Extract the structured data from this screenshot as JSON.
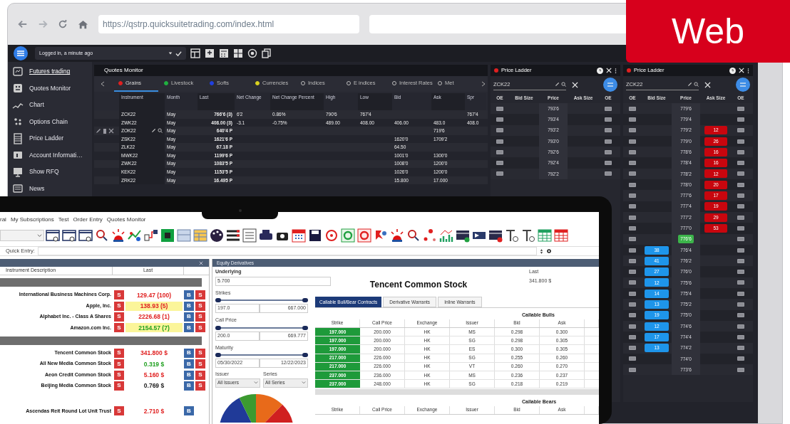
{
  "web_badge": "Web",
  "browser": {
    "url": "https://qstrp.quicksuitetrading.com/index.html"
  },
  "app": {
    "status": "Logged in, a minute ago",
    "sidebar": [
      {
        "label": "Futures trading",
        "selected": true
      },
      {
        "label": "Quotes Monitor",
        "selected": false
      },
      {
        "label": "Chart",
        "selected": false
      },
      {
        "label": "Options Chain",
        "selected": false
      },
      {
        "label": "Price Ladder",
        "selected": false
      },
      {
        "label": "Account Informati…",
        "selected": false
      },
      {
        "label": "Show RFQ",
        "selected": false
      },
      {
        "label": "News",
        "selected": false
      }
    ],
    "quotes_monitor": {
      "title": "Quotes Monitor",
      "tabs": [
        {
          "label": "Grains",
          "color": "#e02020",
          "selected": true
        },
        {
          "label": "Livestock",
          "color": "#20b040",
          "selected": false
        },
        {
          "label": "Softs",
          "color": "#2040e0",
          "selected": false
        },
        {
          "label": "Currencies",
          "color": "#d8d020",
          "selected": false
        },
        {
          "label": "Indices",
          "selected": false
        },
        {
          "label": "E indices",
          "selected": false
        },
        {
          "label": "Interest Rates",
          "selected": false
        },
        {
          "label": "Met",
          "selected": false
        }
      ],
      "columns": [
        "Instrument",
        "Month",
        "Last",
        "Net Change",
        "Net Change Percent",
        "High",
        "Low",
        "Bid",
        "Ask",
        "Spr"
      ],
      "rows": [
        {
          "instrument": "ZCK22",
          "month": "May",
          "last": "766'6 (3)",
          "net_change": "6'2",
          "net_change_percent": "0.86%",
          "high": "790'6",
          "low": "767'4",
          "spr": "767'4",
          "hovered": false
        },
        {
          "instrument": "ZWK22",
          "month": "May",
          "last": "408.00 (3)",
          "net_change": "-3.1",
          "net_change_percent": "-0.75%",
          "high": "489.00",
          "low": "408.00",
          "bid": "406.00",
          "ask": "483.0",
          "spr": "408.0",
          "hovered": false
        },
        {
          "instrument": "ZOK22",
          "month": "May",
          "last": "640'4 P",
          "ask": "719'6",
          "hovered": true
        },
        {
          "instrument": "ZSK22",
          "month": "May",
          "last": "1621'6 P",
          "bid": "1620'0",
          "ask": "1709'2",
          "hovered": false
        },
        {
          "instrument": "ZLK22",
          "month": "May",
          "last": "67.18 P",
          "bid": "64.50",
          "hovered": false
        },
        {
          "instrument": "MWK22",
          "month": "May",
          "last": "1199'6 P",
          "bid": "1001'0",
          "ask": "1300'0",
          "hovered": false
        },
        {
          "instrument": "ZWK22",
          "month": "May",
          "last": "1083'5 P",
          "bid": "1008'0",
          "ask": "1200'0",
          "hovered": false
        },
        {
          "instrument": "KEK22",
          "month": "May",
          "last": "1153'5 P",
          "bid": "1026'0",
          "ask": "1200'0",
          "hovered": false
        },
        {
          "instrument": "ZRK22",
          "month": "May",
          "last": "16.495 P",
          "bid": "15.800",
          "ask": "17.000",
          "hovered": false
        }
      ]
    },
    "price_ladders": [
      {
        "title": "Price Ladder",
        "symbol": "ZCK22",
        "columns": [
          "OE",
          "Bid Size",
          "Price",
          "Ask Size",
          "OE"
        ],
        "rows": [
          {
            "price": "793'6",
            "last": false
          },
          {
            "price": "793'4",
            "last": false
          },
          {
            "price": "793'2",
            "last": false
          },
          {
            "price": "793'0",
            "last": false
          },
          {
            "price": "792'6",
            "last": false
          },
          {
            "price": "792'4",
            "last": false
          },
          {
            "price": "792'2",
            "last": false
          }
        ]
      },
      {
        "title": "Price Ladder",
        "symbol": "ZCK22",
        "columns": [
          "OE",
          "Bid Size",
          "Price",
          "Ask Size",
          "OE"
        ],
        "rows": [
          {
            "price": "779'6",
            "last": false
          },
          {
            "price": "779'4",
            "last": false
          },
          {
            "price": "779'2",
            "ask": "12",
            "last": false
          },
          {
            "price": "779'0",
            "ask": "26",
            "last": false
          },
          {
            "price": "778'6",
            "ask": "16",
            "last": false
          },
          {
            "price": "778'4",
            "ask": "16",
            "last": false
          },
          {
            "price": "778'2",
            "ask": "12",
            "last": false
          },
          {
            "price": "778'0",
            "ask": "20",
            "last": false
          },
          {
            "price": "777'6",
            "ask": "17",
            "last": false
          },
          {
            "price": "777'4",
            "ask": "19",
            "last": false
          },
          {
            "price": "777'2",
            "ask": "29",
            "last": false
          },
          {
            "price": "777'0",
            "ask": "53",
            "last": false
          },
          {
            "price": "776'6",
            "last": true
          },
          {
            "price": "776'4",
            "bid": "38",
            "last": false
          },
          {
            "price": "776'2",
            "bid": "41",
            "last": false
          },
          {
            "price": "776'0",
            "bid": "27",
            "last": false
          },
          {
            "price": "775'6",
            "bid": "12",
            "last": false
          },
          {
            "price": "775'4",
            "bid": "14",
            "last": false
          },
          {
            "price": "775'2",
            "bid": "13",
            "last": false
          },
          {
            "price": "775'0",
            "bid": "19",
            "last": false
          },
          {
            "price": "774'6",
            "bid": "12",
            "last": false
          },
          {
            "price": "774'4",
            "bid": "17",
            "last": false
          },
          {
            "price": "774'2",
            "bid": "13",
            "last": false
          },
          {
            "price": "774'0",
            "last": false
          },
          {
            "price": "773'6",
            "last": false
          }
        ]
      }
    ]
  },
  "desktop": {
    "menu": [
      "ral",
      "My Subscriptions",
      "Test",
      "Order Entry",
      "Quotes Monitor"
    ],
    "quick_entry_label": "Quick Entry:",
    "watchlist": {
      "columns": [
        "Instrument Description",
        "Last"
      ],
      "groups": [
        {
          "bar": true,
          "rows": [
            {
              "name": "International Business Machines Corp.",
              "last": "129.47 (100)",
              "kind": "down",
              "highlight": false,
              "buttons": [
                {
                  "label": "S",
                  "kind": "sell"
                },
                {
                  "label": "B",
                  "kind": "buy"
                },
                {
                  "label": "S",
                  "kind": "sell"
                }
              ]
            },
            {
              "name": "Apple, Inc.",
              "last": "138.93 (5)",
              "kind": "down",
              "highlight": true,
              "buttons": [
                {
                  "label": "S",
                  "kind": "sell"
                },
                {
                  "label": "B",
                  "kind": "buy"
                },
                {
                  "label": "S",
                  "kind": "sell"
                }
              ]
            },
            {
              "name": "Alphabet Inc. - Class A Shares",
              "last": "2226.68 (1)",
              "kind": "down",
              "highlight": false,
              "buttons": [
                {
                  "label": "S",
                  "kind": "sell"
                },
                {
                  "label": "B",
                  "kind": "buy"
                },
                {
                  "label": "S",
                  "kind": "sell"
                }
              ]
            },
            {
              "name": "Amazon.com Inc.",
              "last": "2154.57 (7)",
              "kind": "up",
              "highlight": true,
              "buttons": [
                {
                  "label": "S",
                  "kind": "sell"
                },
                {
                  "label": "B",
                  "kind": "buy"
                },
                {
                  "label": "S",
                  "kind": "sell"
                }
              ]
            }
          ]
        },
        {
          "bar": true,
          "rows": [
            {
              "name": "Tencent Common Stock",
              "last": "341.800 $",
              "kind": "down",
              "highlight": false,
              "buttons": [
                {
                  "label": "S",
                  "kind": "sell"
                },
                {
                  "label": "B",
                  "kind": "buy"
                },
                {
                  "label": "S",
                  "kind": "sell"
                }
              ]
            },
            {
              "name": "All New Media Common Stock",
              "last": "0.319 $",
              "kind": "up",
              "highlight": false,
              "buttons": [
                {
                  "label": "S",
                  "kind": "sell"
                },
                {
                  "label": "B",
                  "kind": "buy"
                },
                {
                  "label": "S",
                  "kind": "sell"
                }
              ]
            },
            {
              "name": "Aeon Credit Common Stock",
              "last": "5.160 $",
              "kind": "down",
              "highlight": false,
              "buttons": [
                {
                  "label": "S",
                  "kind": "sell"
                },
                {
                  "label": "B",
                  "kind": "buy"
                },
                {
                  "label": "S",
                  "kind": "sell"
                }
              ]
            },
            {
              "name": "Beijing Media Common Stock",
              "last": "0.769 $",
              "kind": "flat",
              "highlight": false,
              "buttons": [
                {
                  "label": "S",
                  "kind": "sell"
                },
                {
                  "label": "B",
                  "kind": "buy"
                },
                {
                  "label": "S",
                  "kind": "sell"
                }
              ]
            }
          ]
        },
        {
          "bar": false,
          "rows": [
            {
              "name": "Ascendas Reit Round Lot Unit Trust",
              "last": "2.710 $",
              "kind": "down",
              "highlight": false,
              "buttons": [
                {
                  "label": "S",
                  "kind": "sell"
                },
                {
                  "label": "B",
                  "kind": "buy"
                }
              ]
            }
          ]
        }
      ]
    },
    "equity": {
      "title": "Equity Derivatives",
      "underlying_label": "Underlying",
      "underlying": "5.700",
      "filters": [
        {
          "label": "Strikes",
          "from": "197.0",
          "to": "667.000",
          "level": 1
        },
        {
          "label": "Call Price",
          "from": "200.0",
          "to": "669.777",
          "level": 1
        },
        {
          "label": "Maturity",
          "from": "05/30/2022",
          "to": "12/22/2023",
          "level": 1
        }
      ],
      "issuer_label": "Issuer",
      "issuer": "All Issuers",
      "series_label": "Series",
      "series": "All Series",
      "instrument": "Tencent Common Stock",
      "last_label": "Last",
      "last": "341.800 $",
      "tabs": [
        {
          "label": "Callable Bull/Bear Contracts",
          "selected": true
        },
        {
          "label": "Derivative Warrants",
          "selected": false
        },
        {
          "label": "Inline Warrants",
          "selected": false
        }
      ],
      "bulls": {
        "title": "Callable Bulls",
        "columns": [
          "Strike",
          "Call Price",
          "Exchange",
          "Issuer",
          "Bid",
          "Ask"
        ],
        "rows": [
          [
            "197.000",
            "200.000",
            "HK",
            "MS",
            "0.298",
            "0.300"
          ],
          [
            "197.000",
            "200.000",
            "HK",
            "SG",
            "0.298",
            "0.305"
          ],
          [
            "197.000",
            "200.000",
            "HK",
            "ES",
            "0.300",
            "0.305"
          ],
          [
            "217.000",
            "226.000",
            "HK",
            "SG",
            "0.255",
            "0.260"
          ],
          [
            "217.000",
            "226.000",
            "HK",
            "VT",
            "0.260",
            "0.270"
          ],
          [
            "237.000",
            "236.000",
            "HK",
            "MS",
            "0.236",
            "0.237"
          ],
          [
            "237.000",
            "248.000",
            "HK",
            "SG",
            "0.218",
            "0.219"
          ]
        ]
      },
      "bears": {
        "title": "Callable Bears",
        "columns": [
          "Strike",
          "Call Price",
          "Exchange",
          "Issuer",
          "Bid",
          "Ask"
        ]
      }
    }
  }
}
